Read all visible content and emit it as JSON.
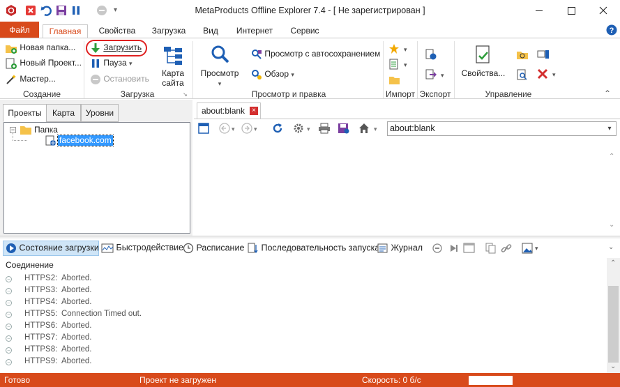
{
  "window": {
    "title": "MetaProducts Offline Explorer 7.4 - [ Не зарегистрирован ]"
  },
  "ribbon_tabs": [
    "Файл",
    "Главная",
    "Свойства",
    "Загрузка",
    "Вид",
    "Интернет",
    "Сервис"
  ],
  "ribbon": {
    "create": {
      "new_folder": "Новая папка...",
      "new_project": "Новый Проект...",
      "wizard": "Мастер...",
      "group": "Создание"
    },
    "download": {
      "start": "Загрузить",
      "pause": "Пауза",
      "stop": "Остановить",
      "site_map": "Карта сайта",
      "group": "Загрузка"
    },
    "view": {
      "view": "Просмотр",
      "autosave": "Просмотр с автосохранением",
      "browse": "Обзор",
      "group": "Просмотр и правка"
    },
    "import": {
      "group": "Импорт"
    },
    "export": {
      "group": "Экспорт"
    },
    "manage": {
      "properties": "Свойства...",
      "group": "Управление"
    }
  },
  "left_panel": {
    "tabs": [
      "Проекты",
      "Карта",
      "Уровни"
    ],
    "tree": {
      "folder": "Папка",
      "project": "facebook.com"
    }
  },
  "browser": {
    "tab": "about:blank",
    "address": "about:blank"
  },
  "bottom_toolbar": [
    "Состояние загрузки",
    "Быстродействие",
    "Расписание",
    "Последовательность запуска",
    "Журнал"
  ],
  "log": {
    "header": "Соединение",
    "rows": [
      {
        "conn": "HTTPS2:",
        "msg": "Aborted."
      },
      {
        "conn": "HTTPS3:",
        "msg": "Aborted."
      },
      {
        "conn": "HTTPS4:",
        "msg": "Aborted."
      },
      {
        "conn": "HTTPS5:",
        "msg": "Connection Timed out."
      },
      {
        "conn": "HTTPS6:",
        "msg": "Aborted."
      },
      {
        "conn": "HTTPS7:",
        "msg": "Aborted."
      },
      {
        "conn": "HTTPS8:",
        "msg": "Aborted."
      },
      {
        "conn": "HTTPS9:",
        "msg": "Aborted."
      }
    ]
  },
  "status": {
    "left": "Готово",
    "project": "Проект не загружен",
    "speed": "Скорость: 0 б/с"
  },
  "colors": {
    "accent": "#d84a1b",
    "selection": "#3399ff"
  }
}
